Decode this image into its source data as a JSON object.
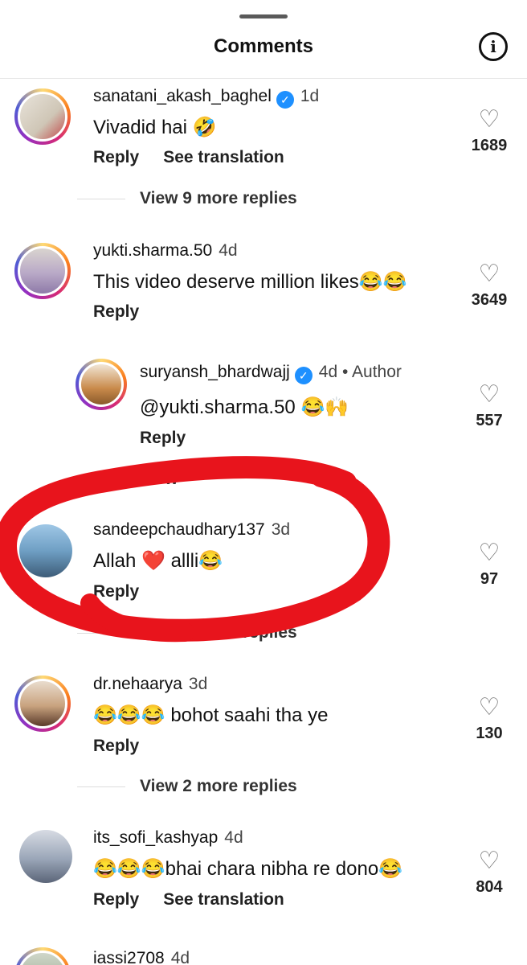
{
  "header": {
    "title": "Comments"
  },
  "comments": [
    {
      "username": "sanatani_akash_baghel",
      "verified": true,
      "time": "1d",
      "text": "Vivadid hai 🤣",
      "reply": "Reply",
      "translate": "See translation",
      "likes": "1689",
      "view_more": "View 9 more replies"
    },
    {
      "username": "yukti.sharma.50",
      "verified": false,
      "time": "4d",
      "text": "This video deserve million likes😂😂",
      "reply": "Reply",
      "likes": "3649"
    },
    {
      "username": "suryansh_bhardwajj",
      "verified": true,
      "time": "4d",
      "author": "• Author",
      "text": "@yukti.sharma.50 😂🙌",
      "reply": "Reply",
      "likes": "557",
      "view_more": "View"
    },
    {
      "username": "sandeepchaudhary137",
      "verified": false,
      "time": "3d",
      "text": "Allah ❤️ allli😂",
      "reply": "Reply",
      "likes": "97",
      "view_more": "View 2 more replies"
    },
    {
      "username": "dr.nehaarya",
      "verified": false,
      "time": "3d",
      "text": "😂😂😂 bohot  saahi tha ye",
      "reply": "Reply",
      "likes": "130",
      "view_more": "View 2 more replies"
    },
    {
      "username": "its_sofi_kashyap",
      "verified": false,
      "time": "4d",
      "text": "😂😂😂bhai chara nibha re dono😂",
      "reply": "Reply",
      "translate": "See translation",
      "likes": "804"
    },
    {
      "username": "iassi2708",
      "time": "4d"
    }
  ],
  "annotation_color": "#e8141c"
}
